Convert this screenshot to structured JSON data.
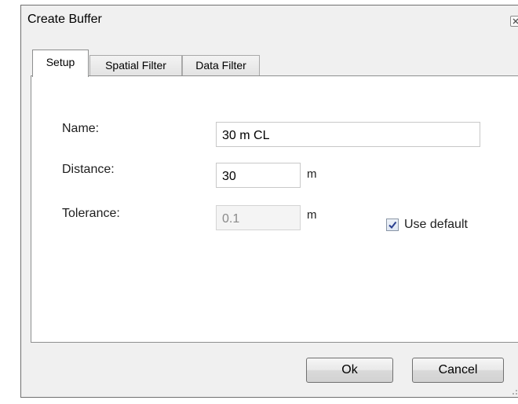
{
  "window": {
    "title": "Create Buffer",
    "close_icon": "close-icon"
  },
  "tabs": [
    {
      "label": "Setup",
      "active": true
    },
    {
      "label": "Spatial Filter",
      "active": false
    },
    {
      "label": "Data Filter",
      "active": false
    }
  ],
  "setup": {
    "name": {
      "label": "Name:",
      "value": "30 m CL"
    },
    "distance": {
      "label": "Distance:",
      "value": "30",
      "unit": "m"
    },
    "tolerance": {
      "label": "Tolerance:",
      "value": "0.1",
      "unit": "m",
      "disabled": true
    },
    "use_default": {
      "label": "Use default",
      "checked": true
    }
  },
  "buttons": {
    "ok": "Ok",
    "cancel": "Cancel"
  }
}
